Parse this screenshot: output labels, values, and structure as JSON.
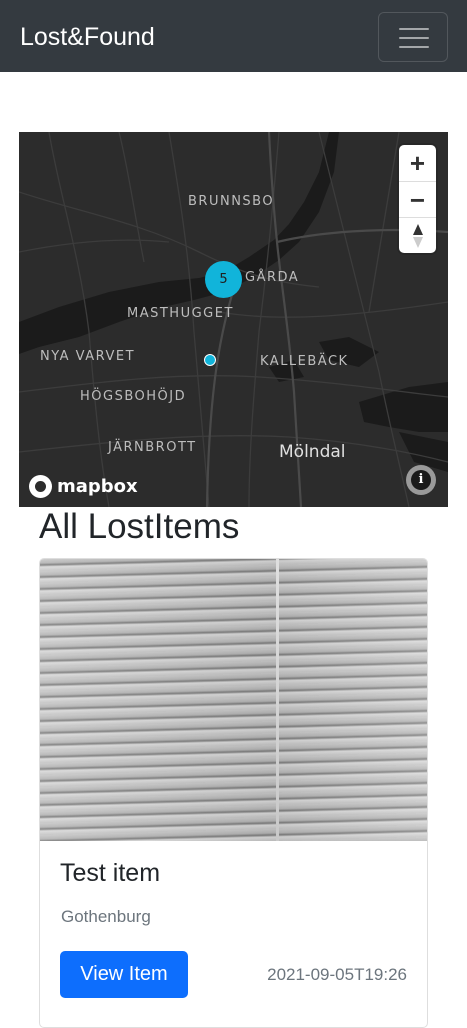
{
  "navbar": {
    "brand": "Lost&Found",
    "toggler_icon": "hamburger-icon"
  },
  "map": {
    "places": {
      "brunnsbo": "BRUNNSBO",
      "garda": "GÅRDA",
      "masthugget": "MASTHUGGET",
      "nya_varvet": "NYA VARVET",
      "kalleback": "KALLEBÄCK",
      "hogsbohojd": "HÖGSBOHÖJD",
      "jarnbrott": "JÄRNBROTT",
      "molndal": "Mölndal"
    },
    "cluster_count": "5",
    "controls": {
      "zoom_in": "+",
      "zoom_out": "−",
      "compass_icon": "compass-icon"
    },
    "logo_text": "mapbox",
    "info": "i",
    "colors": {
      "background": "#2c2c2c",
      "marker": "#11b4da"
    }
  },
  "section": {
    "title": "All LostItems"
  },
  "items": [
    {
      "title": "Test item",
      "location": "Gothenburg",
      "button_label": "View Item",
      "date": "2021-09-05T19:26"
    }
  ],
  "colors": {
    "navbar": "#343a40",
    "primary": "#0d6efd"
  }
}
